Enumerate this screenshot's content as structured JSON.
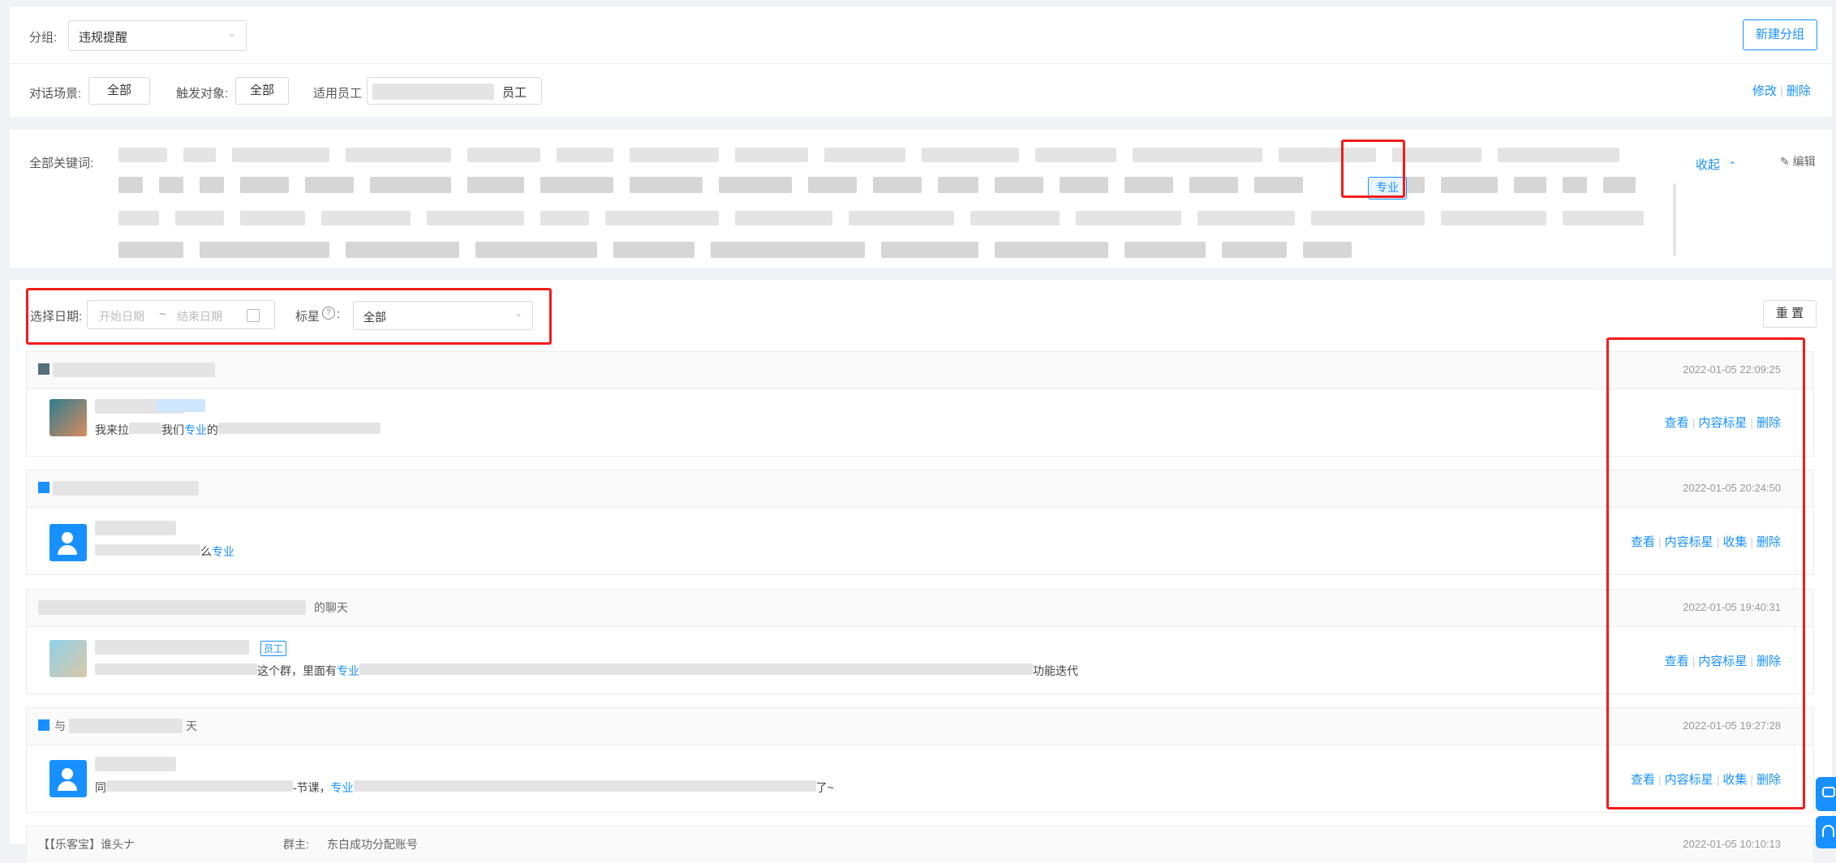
{
  "group_bar": {
    "group_label": "分组:",
    "group_value": "违规提醒",
    "new_group_button": "新建分组",
    "scene_label": "对话场景:",
    "scene_value": "全部",
    "trigger_label": "触发对象:",
    "trigger_value": "全部",
    "staff_label": "适用员工",
    "staff_value_suffix": "员工",
    "edit_link": "修改",
    "delete_link": "删除"
  },
  "keywords": {
    "label": "全部关键词:",
    "highlighted_keyword": "专业",
    "collapse_link": "收起",
    "edit_link": "编辑"
  },
  "filters": {
    "date_label": "选择日期:",
    "start_placeholder": "开始日期",
    "range_sep": "~",
    "end_placeholder": "结束日期",
    "star_label": "标星",
    "star_value": "全部",
    "reset_button": "重 置"
  },
  "records": [
    {
      "timestamp": "2022-01-05 22:09:25",
      "msg_prefix": "我来拉",
      "msg_mid": "我们",
      "keyword": "专业",
      "msg_suffix": "的",
      "actions": {
        "view": "查看",
        "star": "内容标星",
        "delete": "删除"
      }
    },
    {
      "timestamp": "2022-01-05 20:24:50",
      "msg_prefix": "么",
      "keyword": "专业",
      "actions": {
        "view": "查看",
        "star": "内容标星",
        "collect": "收集",
        "delete": "删除"
      }
    },
    {
      "timestamp": "2022-01-05 19:40:31",
      "title_suffix": "的聊天",
      "tag": "员工",
      "msg_prefix": "这个群，里面有",
      "keyword": "专业",
      "msg_suffix": "功能迭代",
      "actions": {
        "view": "查看",
        "star": "内容标星",
        "delete": "删除"
      }
    },
    {
      "timestamp": "2022-01-05 19:27:28",
      "title_prefix": "与",
      "title_suffix": "天",
      "msg_prefix": "同",
      "msg_mid": "-节课，",
      "keyword": "专业",
      "msg_suffix": "了~",
      "actions": {
        "view": "查看",
        "star": "内容标星",
        "collect": "收集",
        "delete": "删除"
      }
    }
  ],
  "partial_row": {
    "title_start": "【【乐客宝】谁头ナ",
    "title_mid": "群主:",
    "owner": "东白成功分配账号",
    "timestamp": "2022-01-05 10:10:13"
  },
  "colors": {
    "primary": "#1890ff",
    "highlight_box": "#f21c1c",
    "background": "#f0f2f5"
  }
}
